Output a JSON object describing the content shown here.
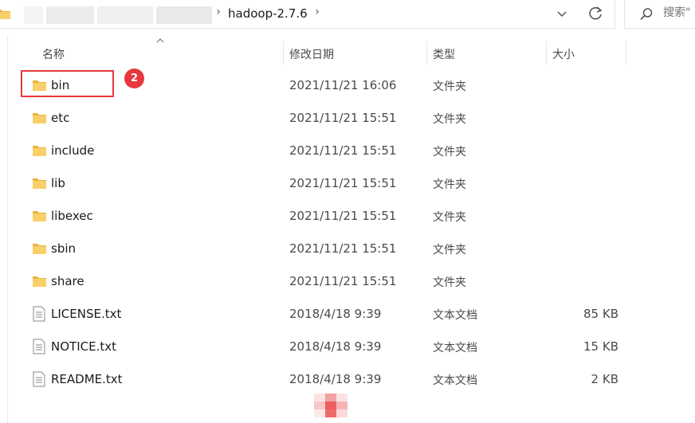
{
  "address_bar": {
    "path_current": "hadoop-2.7.6",
    "dropdown_glyph": "∨",
    "refresh_icon": "refresh-icon"
  },
  "search": {
    "placeholder": "搜索\""
  },
  "columns": {
    "name": "名称",
    "date": "修改日期",
    "type": "类型",
    "size": "大小"
  },
  "files": [
    {
      "name": "bin",
      "date": "2021/11/21 16:06",
      "type": "文件夹",
      "size": "",
      "icon": "folder-icon"
    },
    {
      "name": "etc",
      "date": "2021/11/21 15:51",
      "type": "文件夹",
      "size": "",
      "icon": "folder-icon"
    },
    {
      "name": "include",
      "date": "2021/11/21 15:51",
      "type": "文件夹",
      "size": "",
      "icon": "folder-icon"
    },
    {
      "name": "lib",
      "date": "2021/11/21 15:51",
      "type": "文件夹",
      "size": "",
      "icon": "folder-icon"
    },
    {
      "name": "libexec",
      "date": "2021/11/21 15:51",
      "type": "文件夹",
      "size": "",
      "icon": "folder-icon"
    },
    {
      "name": "sbin",
      "date": "2021/11/21 15:51",
      "type": "文件夹",
      "size": "",
      "icon": "folder-icon"
    },
    {
      "name": "share",
      "date": "2021/11/21 15:51",
      "type": "文件夹",
      "size": "",
      "icon": "folder-icon"
    },
    {
      "name": "LICENSE.txt",
      "date": "2018/4/18 9:39",
      "type": "文本文档",
      "size": "85 KB",
      "icon": "text-file-icon"
    },
    {
      "name": "NOTICE.txt",
      "date": "2018/4/18 9:39",
      "type": "文本文档",
      "size": "15 KB",
      "icon": "text-file-icon"
    },
    {
      "name": "README.txt",
      "date": "2018/4/18 9:39",
      "type": "文本文档",
      "size": "2 KB",
      "icon": "text-file-icon"
    }
  ],
  "annotation": {
    "step_number": "2",
    "color": "#e8383d"
  },
  "colors": {
    "folder_body": "#f8d06b",
    "folder_tab": "#e8b33e",
    "accent_red": "#e8383d"
  }
}
